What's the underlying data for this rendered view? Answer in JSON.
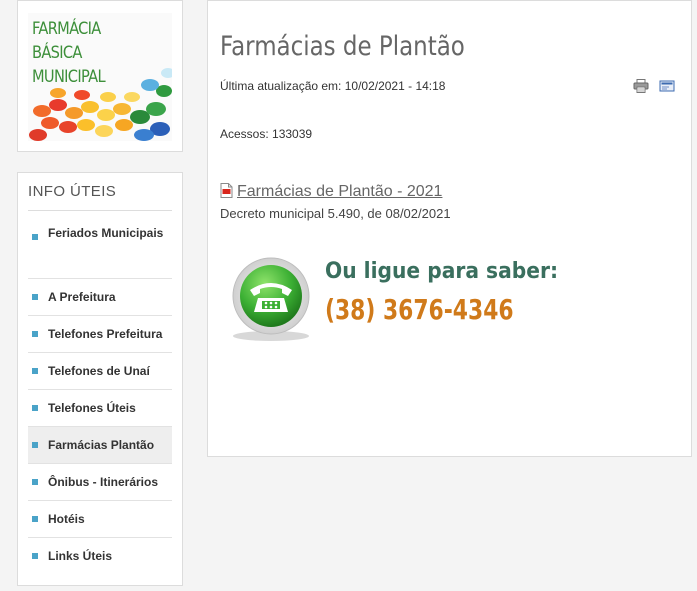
{
  "banner": {
    "title": "FARMÁCIA BÁSICA MUNICIPAL"
  },
  "sidebar": {
    "heading": "INFO ÚTEIS",
    "items": [
      {
        "label": "Feriados Municipais"
      },
      {
        "label": "A Prefeitura"
      },
      {
        "label": "Telefones Prefeitura"
      },
      {
        "label": "Telefones de Unaí"
      },
      {
        "label": "Telefones Úteis"
      },
      {
        "label": "Farmácias Plantão"
      },
      {
        "label": "Ônibus - Itinerários"
      },
      {
        "label": "Hotéis"
      },
      {
        "label": "Links Úteis"
      }
    ],
    "active_index": 5
  },
  "article": {
    "title": "Farmácias de Plantão",
    "updated": "Última atualização em: 10/02/2021 - 14:18",
    "hits": "Acessos: 133039",
    "document_link": "Farmácias de Plantão - 2021",
    "document_description": "Decreto municipal 5.490, de 08/02/2021",
    "call_text": "Ou ligue para saber:",
    "phone": "(38) 3676-4346"
  },
  "icons": [
    "print-icon",
    "email-icon",
    "pdf-icon",
    "phone-icon",
    "bullet-icon"
  ],
  "colors": {
    "banner_text": "#3d8f3a",
    "bullet": "#4aa3c8",
    "call_text": "#3a6f5e",
    "phone_number": "#d07a1a",
    "phone_green": "#3cb034"
  }
}
